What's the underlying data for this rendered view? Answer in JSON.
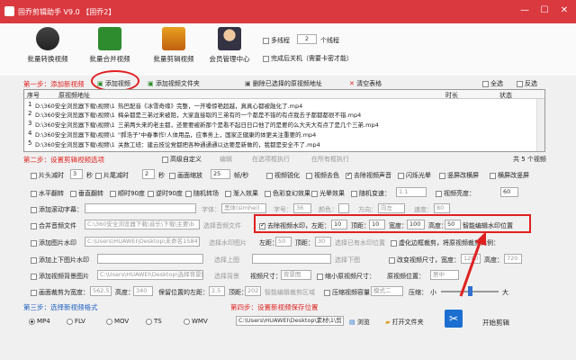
{
  "window": {
    "title": "固乔剪辑助手 V9.0 【固乔2】"
  },
  "toolbar": {
    "items": [
      "批量转换视频",
      "批量合并视频",
      "批量剪辑视频",
      "会员管理中心"
    ],
    "multithread_label": "多线程",
    "threads": "2",
    "threads_unit": "个线程",
    "shutdown_label": "完成后关机（需要卡密才能）"
  },
  "step1": {
    "title": "第一步：添加新视频",
    "add_video": "添加视频",
    "add_folder": "添加视频文件夹",
    "delete_selected": "删除已选择的原视频地址",
    "clear_table": "清空表格",
    "select_all": "全选",
    "invert": "反选"
  },
  "table": {
    "headers": [
      "序号",
      "原视频地址",
      "时长",
      "状态"
    ],
    "rows": [
      [
        "1",
        "D:\\360安全浏览器下载\\视频\\1_热巴配音《冰雪奇缘》完整，一开嗓惊艳超越，真真心都被融化了.mp4"
      ],
      [
        "2",
        "D:\\360安全浏览器下载\\视频\\1_梅朵都是三弟过来被阻，大家直接取的三弟有的一个都是不错的有点我去子都都都很不错.mp4"
      ],
      [
        "3",
        "D:\\360安全浏览器下载\\视频\\1_三弟两头来的老主都，还要要被新那个是看不起日日口他了的是要的么大天大有点了是几个三弟.mp4"
      ],
      [
        "4",
        "D:\\360安全浏览器下载\\视频\\1_\"郝浩子\"中春事作!人体用品，应事务上，国家正健康的体更关注重要的.mp4"
      ],
      [
        "5",
        "D:\\360安全浏览器下载\\视频\\1_关数工班：建云技论党都把各种通通通以达要是新做的，我都是安全不了.mp4"
      ]
    ]
  },
  "step2": {
    "title": "第二步：设置剪辑视频选项",
    "custom": "高级自定义",
    "edit": "编辑",
    "exec_current": "在选项框执行",
    "exec_all": "在所有框执行",
    "count": "共 5 个视频"
  },
  "options": {
    "r1": [
      "片头减时",
      "3",
      "秒",
      "片尾减时",
      "2",
      "秒",
      "画面缩放",
      "25",
      "帧/秒",
      "视频锐化",
      "视频去色",
      "去除视频声音",
      "闪烁光晕",
      "竖屏改横屏",
      "横屏改竖屏"
    ],
    "r2": [
      "水平翻转",
      "垂直翻转",
      "顺时90度",
      "逆时90度",
      "随机转场",
      "渐入效果",
      "色彩变幻效果",
      "光晕效果",
      "随机变速：",
      "1.1",
      "视频亮度：",
      "60"
    ],
    "r3": [
      "添加滚动字幕：",
      "字体：",
      "黑体(simhei)",
      "字号：",
      "36",
      "颜色：",
      "方向：",
      "向左",
      "速度：",
      "80"
    ],
    "r4": [
      "合并音频文件",
      "C:\\360安全浏览器下载\\音乐\\下载\\主要\\b",
      "选择音频文件",
      "去除视频水印，左距：",
      "10",
      "顶距：",
      "10",
      "宽度：",
      "100",
      "高度：",
      "50",
      "智能编辑水印位置"
    ],
    "r5": [
      "添加图片水印",
      "C:\\Users\\HUAWEI\\Desktop\\未命名1584790",
      "选择水印图片",
      "左距：",
      "50",
      "顶距：",
      "30",
      "选择已有水印位置",
      "虚化边框裁剪，将原视频裁剪比例："
    ],
    "r6": [
      "添加上下图片水印",
      "选择上图",
      "选择下图",
      "改变视频尺寸，宽度：",
      "1280",
      "高度：",
      "720"
    ],
    "r7": [
      "添加视频背景图片",
      "C:\\Users\\HUAWEI\\Desktop\\选择背景图",
      "选择背景",
      "视频尺寸：",
      "背景图",
      "缩小原视频尺寸：",
      "原视频位置：",
      "居中"
    ],
    "r8": [
      "画面裁剪为宽度：",
      "562.5",
      "高度：",
      "340",
      "保留位置的左距：",
      "2.5",
      "顶距：",
      "202",
      "智能编辑裁剪区域",
      "压缩视频容量",
      "模式二",
      "压缩：",
      "小",
      "大"
    ]
  },
  "step3": {
    "title": "第三步：选择新视频格式",
    "formats": [
      "MP4",
      "FLV",
      "MOV",
      "TS",
      "WMV"
    ]
  },
  "step4": {
    "title": "第四步：设置新视频保存位置",
    "path": "C:\\Users\\HUAWEI\\Desktop\\素材\\1\\剪",
    "browse": "浏览",
    "open_folder": "打开文件夹"
  },
  "start": {
    "label": "开始剪辑"
  },
  "colors": {
    "title_bar": "#d9393f",
    "highlight": "#e02020",
    "step_blue": "#2060c0"
  }
}
